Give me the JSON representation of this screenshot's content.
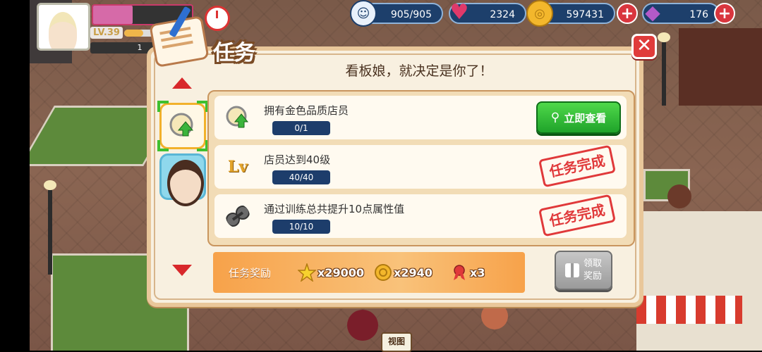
{
  "hud": {
    "player_level": "LV.39",
    "rank_value": "1",
    "pink_bar_fraction": 0.4,
    "stamina": "905/905",
    "hearts": "2324",
    "coins": "597431",
    "gems": "176"
  },
  "dialog": {
    "title": "任务",
    "subtitle": "看板娘，就决定是你了！",
    "close_glyph": "✕"
  },
  "tasks": [
    {
      "title": "拥有金色品质店员",
      "progress": "0/1",
      "action": "立即查看"
    },
    {
      "title": "店员达到40级",
      "progress": "40/40",
      "stamp": "任务完成"
    },
    {
      "title": "通过训练总共提升10点属性值",
      "progress": "10/10",
      "stamp": "任务完成"
    }
  ],
  "rewards": {
    "label": "任务奖励",
    "star_amount": "x29000",
    "coin_amount": "x2940",
    "ribbon_amount": "x3"
  },
  "claim": {
    "label_line1": "领取",
    "label_line2": "奖励"
  },
  "bottom_sign": "视图",
  "colors": {
    "accent_green": "#1fa32a",
    "stamp_red": "#e0393a",
    "dialog_bg": "#f8f0e0"
  }
}
